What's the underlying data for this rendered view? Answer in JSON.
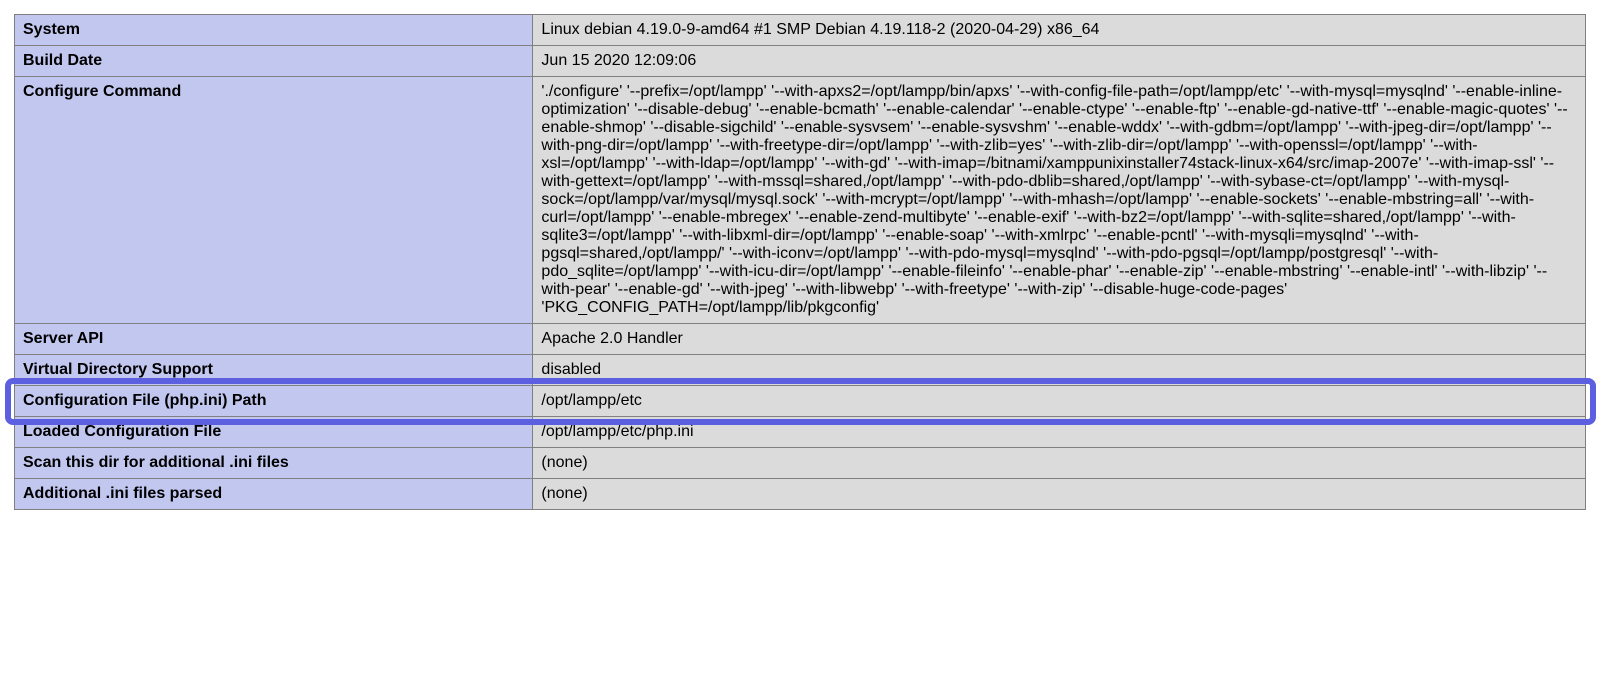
{
  "rows": [
    {
      "label": "System",
      "value": "Linux debian 4.19.0-9-amd64 #1 SMP Debian 4.19.118-2 (2020-04-29) x86_64"
    },
    {
      "label": "Build Date",
      "value": "Jun 15 2020 12:09:06"
    },
    {
      "label": "Configure Command",
      "value": "'./configure' '--prefix=/opt/lampp' '--with-apxs2=/opt/lampp/bin/apxs' '--with-config-file-path=/opt/lampp/etc' '--with-mysql=mysqlnd' '--enable-inline-optimization' '--disable-debug' '--enable-bcmath' '--enable-calendar' '--enable-ctype' '--enable-ftp' '--enable-gd-native-ttf' '--enable-magic-quotes' '--enable-shmop' '--disable-sigchild' '--enable-sysvsem' '--enable-sysvshm' '--enable-wddx' '--with-gdbm=/opt/lampp' '--with-jpeg-dir=/opt/lampp' '--with-png-dir=/opt/lampp' '--with-freetype-dir=/opt/lampp' '--with-zlib=yes' '--with-zlib-dir=/opt/lampp' '--with-openssl=/opt/lampp' '--with-xsl=/opt/lampp' '--with-ldap=/opt/lampp' '--with-gd' '--with-imap=/bitnami/xamppunixinstaller74stack-linux-x64/src/imap-2007e' '--with-imap-ssl' '--with-gettext=/opt/lampp' '--with-mssql=shared,/opt/lampp' '--with-pdo-dblib=shared,/opt/lampp' '--with-sybase-ct=/opt/lampp' '--with-mysql-sock=/opt/lampp/var/mysql/mysql.sock' '--with-mcrypt=/opt/lampp' '--with-mhash=/opt/lampp' '--enable-sockets' '--enable-mbstring=all' '--with-curl=/opt/lampp' '--enable-mbregex' '--enable-zend-multibyte' '--enable-exif' '--with-bz2=/opt/lampp' '--with-sqlite=shared,/opt/lampp' '--with-sqlite3=/opt/lampp' '--with-libxml-dir=/opt/lampp' '--enable-soap' '--with-xmlrpc' '--enable-pcntl' '--with-mysqli=mysqlnd' '--with-pgsql=shared,/opt/lampp/' '--with-iconv=/opt/lampp' '--with-pdo-mysql=mysqlnd' '--with-pdo-pgsql=/opt/lampp/postgresql' '--with-pdo_sqlite=/opt/lampp' '--with-icu-dir=/opt/lampp' '--enable-fileinfo' '--enable-phar' '--enable-zip' '--enable-mbstring' '--enable-intl' '--with-libzip' '--with-pear' '--enable-gd' '--with-jpeg' '--with-libwebp' '--with-freetype' '--with-zip' '--disable-huge-code-pages' 'PKG_CONFIG_PATH=/opt/lampp/lib/pkgconfig'"
    },
    {
      "label": "Server API",
      "value": "Apache 2.0 Handler"
    },
    {
      "label": "Virtual Directory Support",
      "value": "disabled"
    },
    {
      "label": "Configuration File (php.ini) Path",
      "value": "/opt/lampp/etc",
      "highlighted": true
    },
    {
      "label": "Loaded Configuration File",
      "value": "/opt/lampp/etc/php.ini"
    },
    {
      "label": "Scan this dir for additional .ini files",
      "value": "(none)"
    },
    {
      "label": "Additional .ini files parsed",
      "value": "(none)"
    }
  ]
}
